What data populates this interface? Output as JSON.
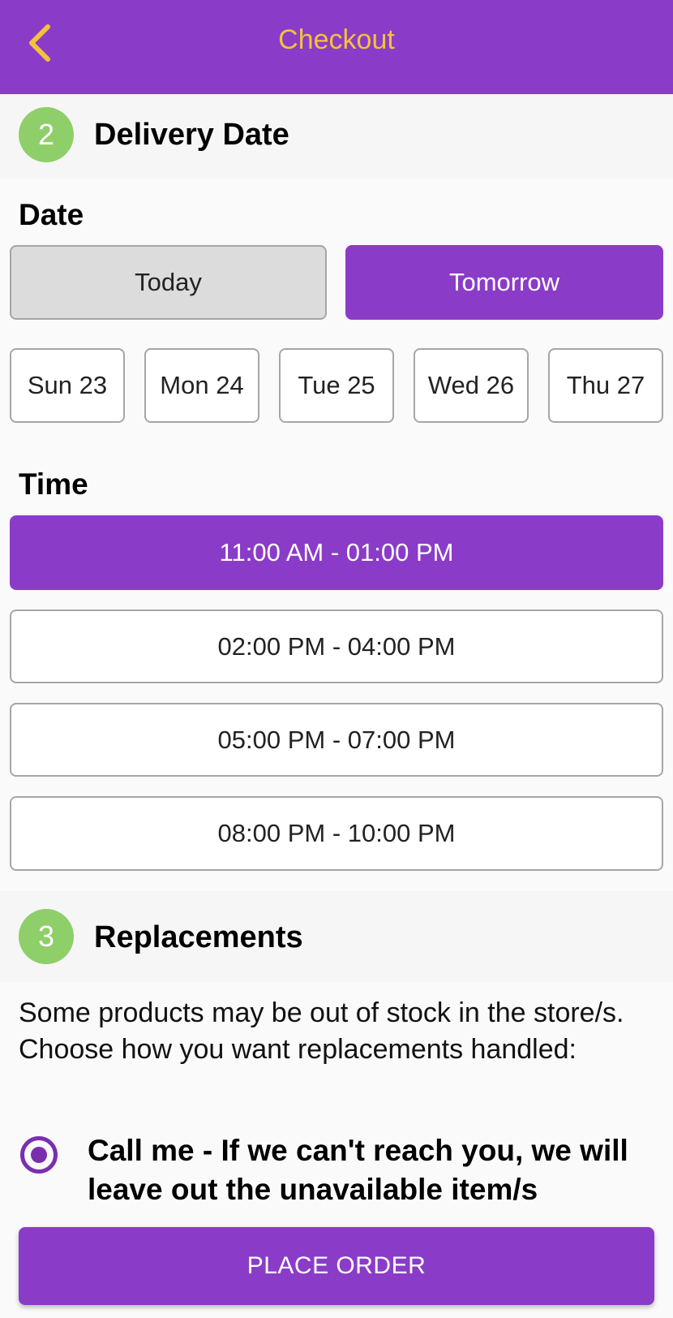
{
  "colors": {
    "primary": "#8a3cc8",
    "title_accent": "#f5c13a",
    "step_badge": "#8fcf6a"
  },
  "header": {
    "title": "Checkout",
    "back_icon": "chevron-left-icon"
  },
  "delivery": {
    "step_number": "2",
    "title": "Delivery Date",
    "date_label": "Date",
    "day_options": [
      {
        "label": "Today",
        "selected": false
      },
      {
        "label": "Tomorrow",
        "selected": true
      }
    ],
    "dates": [
      "Sun 23",
      "Mon 24",
      "Tue 25",
      "Wed 26",
      "Thu 27"
    ],
    "time_label": "Time",
    "time_slots": [
      {
        "label": "11:00 AM - 01:00 PM",
        "selected": true
      },
      {
        "label": "02:00 PM - 04:00 PM",
        "selected": false
      },
      {
        "label": "05:00 PM - 07:00 PM",
        "selected": false
      },
      {
        "label": "08:00 PM - 10:00 PM",
        "selected": false
      }
    ]
  },
  "replacements": {
    "step_number": "3",
    "title": "Replacements",
    "description": "Some products may be out of stock in the store/s. Choose how you want replacements handled:",
    "option_label": "Call me - If we can't reach you, we will leave out the unavailable item/s",
    "option_selected": true
  },
  "footer": {
    "place_order_label": "PLACE ORDER"
  }
}
